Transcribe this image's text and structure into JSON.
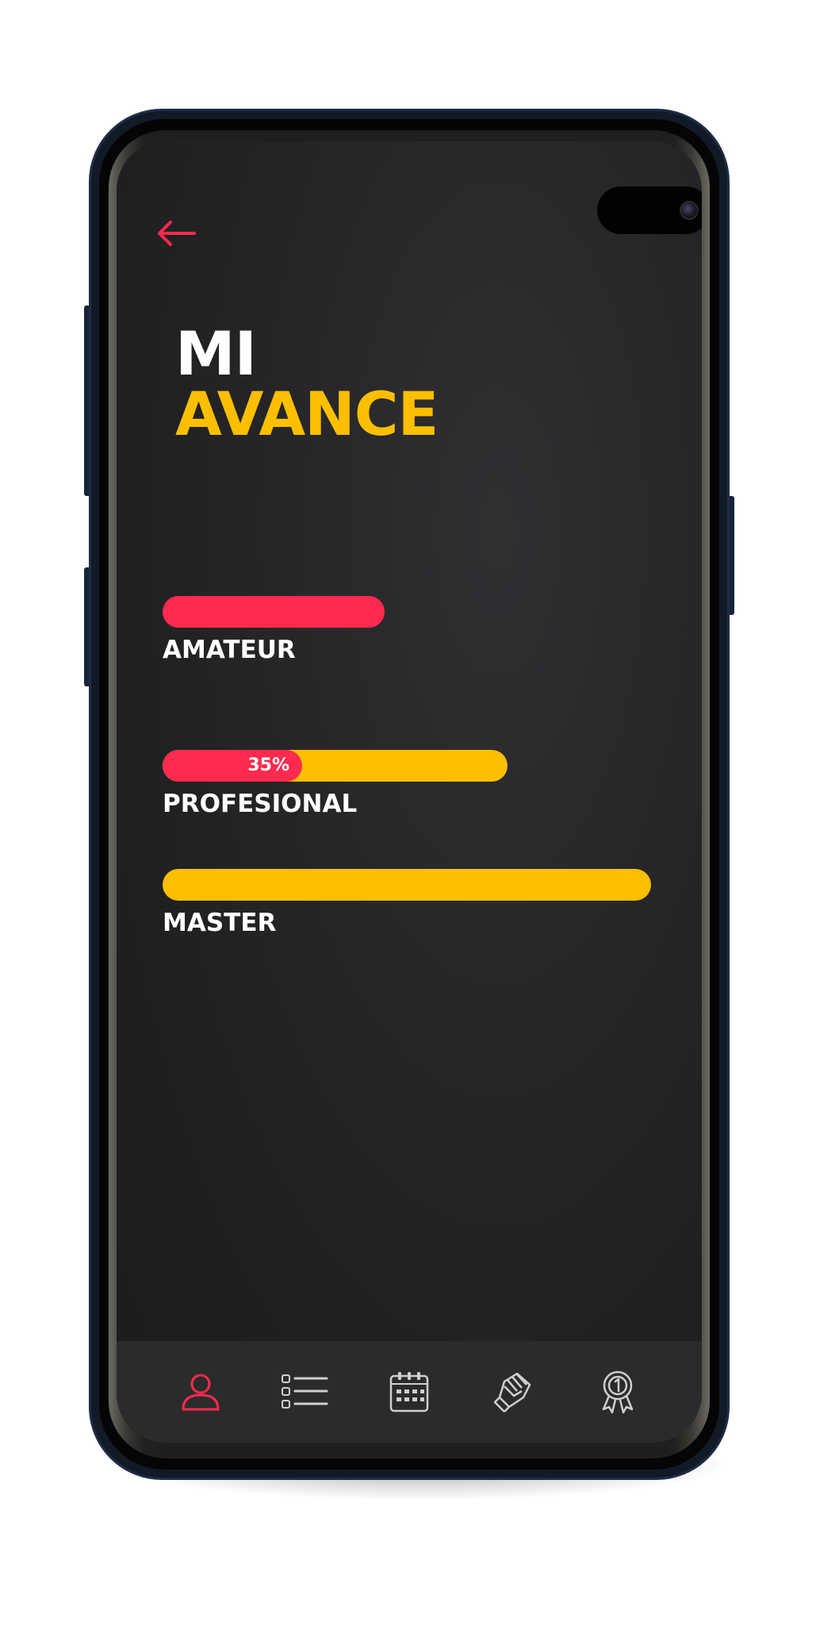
{
  "header": {
    "back_icon": "arrow-left-icon",
    "title_line1": "MI",
    "title_line2": "AVANCE"
  },
  "levels": [
    {
      "label": "AMATEUR",
      "progress_percent": 100,
      "track_color": "#ff2a4d",
      "fill_color": "#ff2a4d",
      "percent_label": ""
    },
    {
      "label": "PROFESIONAL",
      "progress_percent": 35,
      "track_color": "#fbbf00",
      "fill_color": "#ff2a4d",
      "percent_label": "35%"
    },
    {
      "label": "MASTER",
      "progress_percent": 0,
      "track_color": "#fbbf00",
      "fill_color": "#ff2a4d",
      "percent_label": ""
    }
  ],
  "bottom_nav": {
    "items": [
      {
        "icon": "user-icon",
        "active": true
      },
      {
        "icon": "checklist-icon",
        "active": false
      },
      {
        "icon": "calendar-icon",
        "active": false
      },
      {
        "icon": "fist-icon",
        "active": false
      },
      {
        "icon": "award-medal-icon",
        "active": false
      }
    ]
  },
  "colors": {
    "accent_red": "#ff2a4d",
    "accent_yellow": "#fbbf00",
    "background": "#1f1f21",
    "nav_background": "#2b2b2c"
  }
}
